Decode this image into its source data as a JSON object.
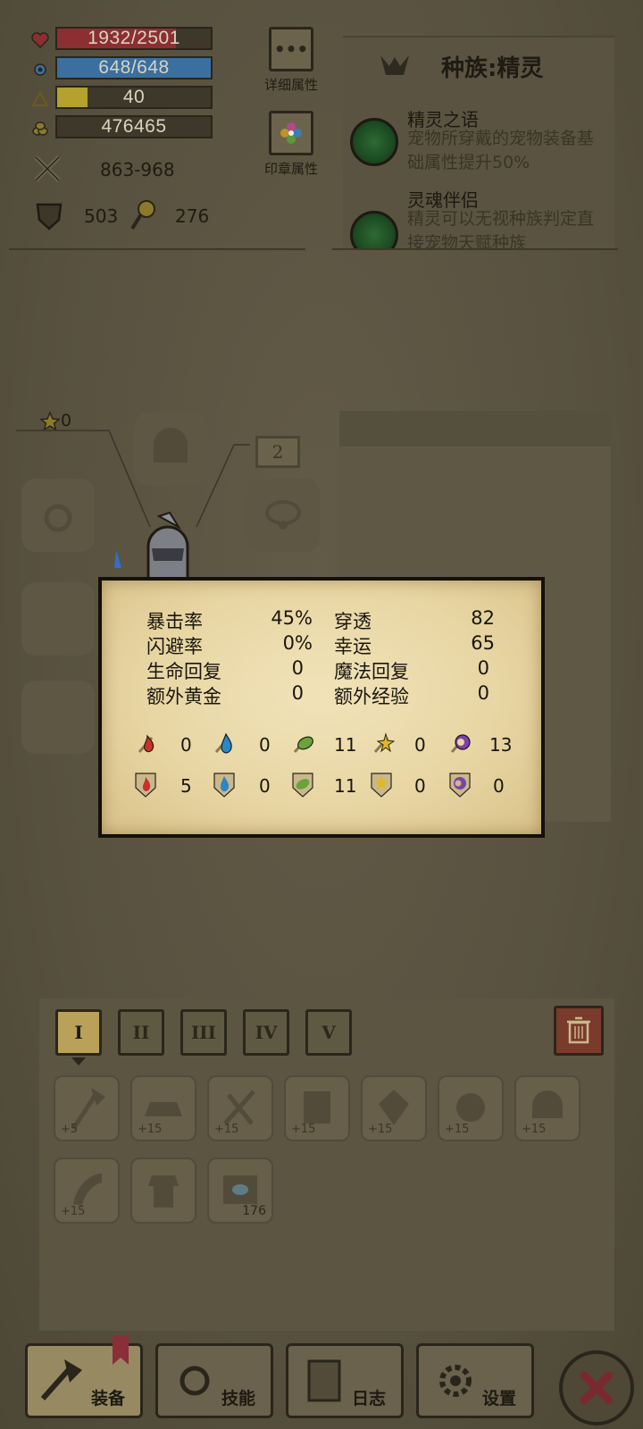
{
  "stats": {
    "hp": {
      "text": "1932/2501",
      "fraction": 0.772,
      "color": "#8c2f32"
    },
    "mp": {
      "text": "648/648",
      "fraction": 1.0,
      "color": "#3b6fa0"
    },
    "level": {
      "text": "40",
      "fraction": 0.2,
      "color": "#b5a12e"
    },
    "gold": {
      "text": "476465"
    },
    "attack": "863-968",
    "defense": "503",
    "magic": "276"
  },
  "side_buttons": {
    "detail": "详细属性",
    "seal": "印章属性"
  },
  "race": {
    "title": "种族:精灵",
    "traits": [
      {
        "name": "精灵之语",
        "desc": "宠物所穿戴的宠物装备基础属性提升50%"
      },
      {
        "name": "灵魂伴侣",
        "desc": "精灵可以无视种族判定直接宠物天赋种族"
      }
    ]
  },
  "equip": {
    "stars": "0",
    "badge": "2"
  },
  "popup": {
    "left": [
      {
        "label": "暴击率",
        "value": "45%"
      },
      {
        "label": "闪避率",
        "value": "0%"
      },
      {
        "label": "生命回复",
        "value": "0"
      },
      {
        "label": "额外黄金",
        "value": "0"
      }
    ],
    "right": [
      {
        "label": "穿透",
        "value": "82"
      },
      {
        "label": "幸运",
        "value": "65"
      },
      {
        "label": "魔法回复",
        "value": "0"
      },
      {
        "label": "额外经验",
        "value": "0"
      }
    ],
    "attack_elements": [
      {
        "icon": "fire-attack-icon",
        "value": "0",
        "color": "#c8322a"
      },
      {
        "icon": "water-attack-icon",
        "value": "0",
        "color": "#2d86c4"
      },
      {
        "icon": "wind-attack-icon",
        "value": "11",
        "color": "#6aa23c"
      },
      {
        "icon": "light-attack-icon",
        "value": "0",
        "color": "#e2b81f"
      },
      {
        "icon": "dark-attack-icon",
        "value": "13",
        "color": "#7a44a6"
      }
    ],
    "resist_elements": [
      {
        "icon": "fire-resist-icon",
        "value": "5",
        "color": "#c8322a"
      },
      {
        "icon": "water-resist-icon",
        "value": "0",
        "color": "#2d86c4"
      },
      {
        "icon": "wind-resist-icon",
        "value": "11",
        "color": "#6aa23c"
      },
      {
        "icon": "light-resist-icon",
        "value": "0",
        "color": "#e2b81f"
      },
      {
        "icon": "dark-resist-icon",
        "value": "0",
        "color": "#7a44a6"
      }
    ]
  },
  "inventory": {
    "tabs": [
      "I",
      "II",
      "III",
      "IV",
      "V"
    ],
    "active_tab": 0,
    "items": [
      {
        "icon": "axe-item-icon",
        "level": "+5"
      },
      {
        "icon": "hat-item-icon",
        "level": "+15"
      },
      {
        "icon": "daggers-item-icon",
        "level": "+15"
      },
      {
        "icon": "book-item-icon",
        "level": "+15"
      },
      {
        "icon": "gem-item-icon",
        "level": "+15"
      },
      {
        "icon": "shield-item-icon",
        "level": "+15"
      },
      {
        "icon": "helmet-item-icon",
        "level": "+15"
      },
      {
        "icon": "horn-item-icon",
        "level": "+15"
      },
      {
        "icon": "armor-item-icon",
        "level": ""
      },
      {
        "icon": "scroll-item-icon",
        "count": "176"
      }
    ]
  },
  "nav": {
    "equip": "装备",
    "skill": "技能",
    "log": "日志",
    "settings": "设置"
  }
}
